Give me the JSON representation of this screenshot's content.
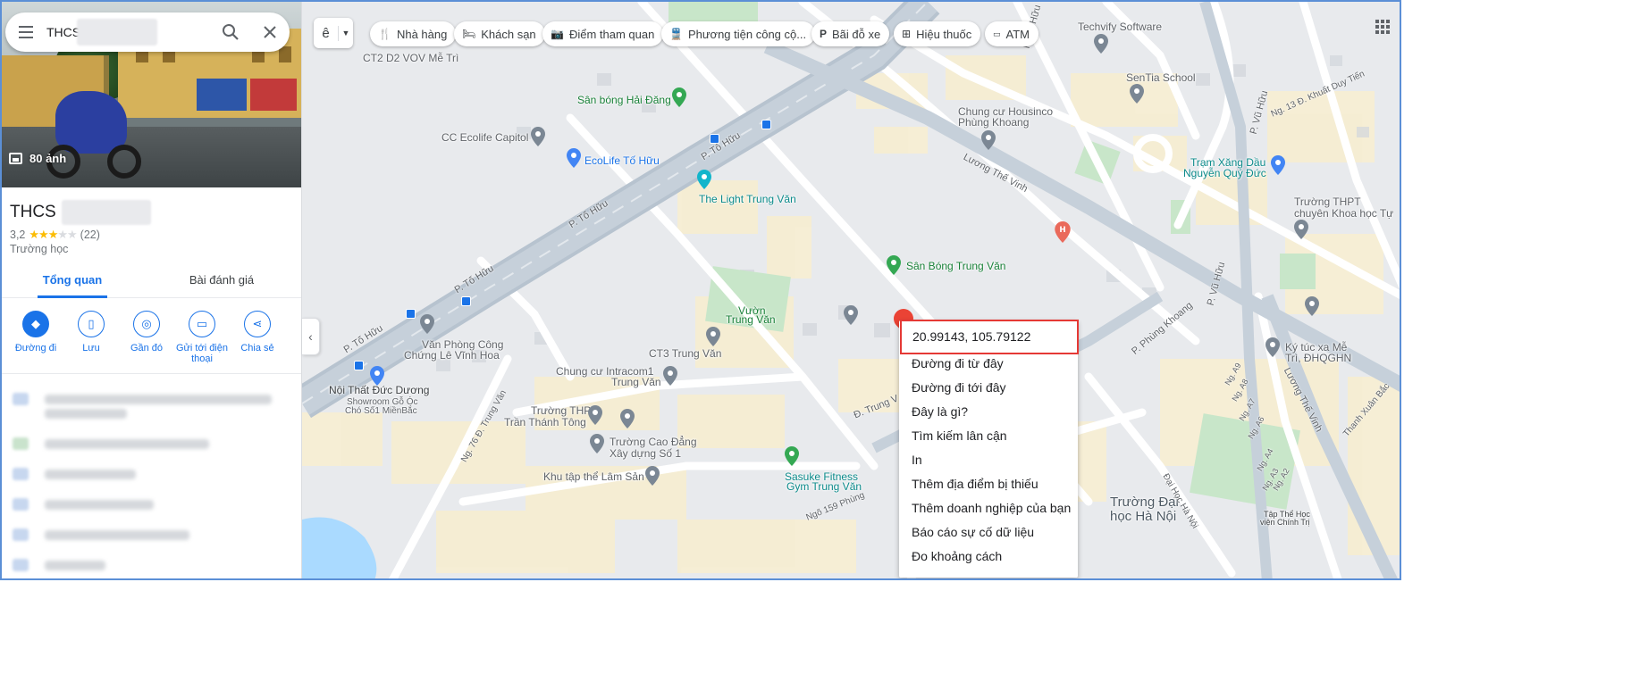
{
  "search": {
    "query_prefix": "THCS"
  },
  "photo": {
    "count_label": "80 ảnh"
  },
  "place": {
    "title_prefix": "THCS",
    "rating": "3,2",
    "stars": 3,
    "review_count": "(22)",
    "category": "Trường học"
  },
  "tabs": [
    {
      "label": "Tổng quan",
      "active": true
    },
    {
      "label": "Bài đánh giá",
      "active": false
    }
  ],
  "actions": [
    {
      "label": "Đường đi",
      "icon": "directions-icon"
    },
    {
      "label": "Lưu",
      "icon": "bookmark-icon"
    },
    {
      "label": "Gần đó",
      "icon": "nearby-icon"
    },
    {
      "label": "Gửi tới điện thoại",
      "icon": "send-to-phone-icon"
    },
    {
      "label": "Chia sẻ",
      "icon": "share-icon"
    }
  ],
  "map_controls": {
    "language_label": "ê",
    "chips": [
      {
        "label": "Nhà hàng",
        "icon": "fork-knife-icon"
      },
      {
        "label": "Khách sạn",
        "icon": "bed-icon"
      },
      {
        "label": "Điểm tham quan",
        "icon": "camera-icon"
      },
      {
        "label": "Phương tiện công cộ...",
        "icon": "transit-icon"
      },
      {
        "label": "Bãi đỗ xe",
        "icon": "parking-icon"
      },
      {
        "label": "Hiệu thuốc",
        "icon": "pharmacy-icon"
      },
      {
        "label": "ATM",
        "icon": "atm-icon"
      }
    ]
  },
  "map_labels": {
    "ct2": "CT2 D2 VOV Mễ Trì",
    "san_bong_hai_dang": "Sân bóng Hải Đăng",
    "cc_ecolife": "CC Ecolife Capitol",
    "ecolife_to_huu": "EcoLife Tố Hữu",
    "the_light": "The Light Trung Văn",
    "san_bong_trung_van": "Sân Bóng Trung Văn",
    "vuon_trung_van_1": "Vườn",
    "vuon_trung_van_2": "Trung Văn",
    "ct3": "CT3 Trung Văn",
    "van_phong_1": "Văn Phòng Công",
    "van_phong_2": "Chứng Lê Vĩnh Hoa",
    "intracom_1": "Chung cư Intracom1",
    "intracom_2": "Trung Văn",
    "noi_that": "Nội Thất Đức Dương",
    "showroom_1": "Showroom Gỗ Óc",
    "showroom_2": "Chó Số1 MiềnBắc",
    "thpt_tran_1": "Trường THPT",
    "thpt_tran_2": "Trần Thánh Tông",
    "cao_dang_1": "Trường Cao Đẳng",
    "cao_dang_2": "Xây dựng Số 1",
    "lam_san": "Khu tập thể Lâm Sản",
    "sasuke_1": "Sasuke Fitness",
    "sasuke_2": "Gym Trung Văn",
    "techvify": "Techvify Software",
    "sentia": "SenTia School",
    "housinco_1": "Chung cư Housinco",
    "housinco_2": "Phùng Khoang",
    "tram_xang_1": "Trạm Xăng Dầu",
    "tram_xang_2": "Nguyễn Quý Đức",
    "thpt_chuyen_1": "Trường THPT",
    "thpt_chuyen_2": "chuyên Khoa học Tự",
    "ky_tuc_1": "Ký túc xa Mễ",
    "ky_tuc_2": "Trì, ĐHQGHN",
    "dh_ha_noi_1": "Trường Đại",
    "dh_ha_noi_2": "học Hà Nội",
    "hoc_vien_1": "Tập Thể Học",
    "hoc_vien_2": "viện Chính Trị"
  },
  "streets": {
    "to_huu_1": "P. Tố Hữu",
    "to_huu_2": "P. Tố Hữu",
    "to_huu_3": "P. Tố Hữu",
    "to_huu_4": "P. Tố Hữu",
    "luong_the_vinh_1": "Lương Thế Vinh",
    "luong_the_vinh_2": "Lương Thế Vinh",
    "phung_khoang": "P. Phùng Khoang",
    "vu_huu_1": "P. Vũ Hữu",
    "vu_huu_2": "P. Vũ Hữu",
    "vu_huu_3": "P. Vũ Hữu",
    "khuat_duy_tien": "Ng. 13 Đ. Khuất Duy Tiến",
    "ng76": "Ng. 76 Đ. Trung Văn",
    "ng159": "Ngõ 159 Phùng",
    "trung_van": "Đ. Trung V",
    "dai_hoc_ha_noi": "Đại Học Hà Nội",
    "thanh_xuan_bac": "Thanh Xuân Bắc",
    "ng_a9": "Ng. A9",
    "ng_a8": "Ng. A8",
    "ng_a7": "Ng. A7",
    "ng_a6": "Ng. A6",
    "ng_a4": "Ng. A4",
    "ng_a3": "Ng. A3",
    "ng_a2": "Ng. A2"
  },
  "context_menu": {
    "coordinates": "20.99143, 105.79122",
    "items": [
      "Đường đi từ đây",
      "Đường đi tới đây",
      "Đây là gì?",
      "Tìm kiếm lân cận",
      "In",
      "Thêm địa điểm bị thiếu",
      "Thêm doanh nghiệp của bạn",
      "Báo cáo sự cố dữ liệu",
      "Đo khoảng cách"
    ]
  },
  "colors": {
    "accent": "#1a73e8",
    "star": "#fbbc04",
    "highlight_border": "#e53935",
    "park": "#c8e6c9",
    "road_main": "#b7c3cf",
    "building": "#fdf0c8"
  }
}
